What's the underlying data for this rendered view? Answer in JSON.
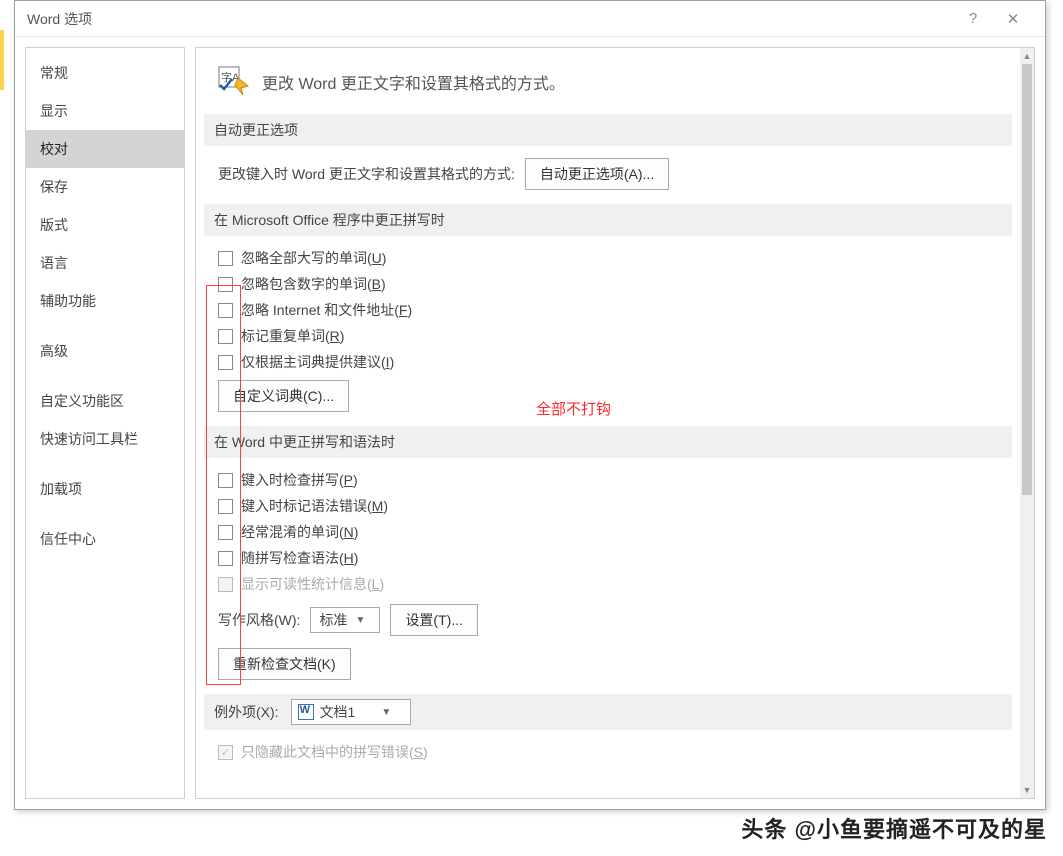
{
  "title": "Word 选项",
  "titlebar": {
    "help": "?",
    "close": "✕"
  },
  "sidebar": {
    "items": [
      {
        "label": "常规",
        "selected": false
      },
      {
        "label": "显示",
        "selected": false
      },
      {
        "label": "校对",
        "selected": true
      },
      {
        "label": "保存",
        "selected": false
      },
      {
        "label": "版式",
        "selected": false
      },
      {
        "label": "语言",
        "selected": false
      },
      {
        "label": "辅助功能",
        "selected": false
      },
      {
        "label": "高级",
        "selected": false
      },
      {
        "label": "自定义功能区",
        "selected": false
      },
      {
        "label": "快速访问工具栏",
        "selected": false
      },
      {
        "label": "加载项",
        "selected": false
      },
      {
        "label": "信任中心",
        "selected": false
      }
    ]
  },
  "header": {
    "text": "更改 Word 更正文字和设置其格式的方式。"
  },
  "section1": {
    "title": "自动更正选项",
    "text": "更改键入时 Word 更正文字和设置其格式的方式:",
    "button": "自动更正选项(A)..."
  },
  "section2": {
    "title": "在 Microsoft Office 程序中更正拼写时",
    "checks": [
      {
        "label": "忽略全部大写的单词",
        "key": "U"
      },
      {
        "label": "忽略包含数字的单词",
        "key": "B"
      },
      {
        "label": "忽略 Internet 和文件地址",
        "key": "F"
      },
      {
        "label": "标记重复单词",
        "key": "R"
      },
      {
        "label": "仅根据主词典提供建议",
        "key": "I"
      }
    ],
    "button": "自定义词典(C)...",
    "note": "全部不打钩"
  },
  "section3": {
    "title": "在 Word 中更正拼写和语法时",
    "checks": [
      {
        "label": "键入时检查拼写",
        "key": "P",
        "disabled": false
      },
      {
        "label": "键入时标记语法错误",
        "key": "M",
        "disabled": false
      },
      {
        "label": "经常混淆的单词",
        "key": "N",
        "disabled": false
      },
      {
        "label": "随拼写检查语法",
        "key": "H",
        "disabled": false
      },
      {
        "label": "显示可读性统计信息",
        "key": "L",
        "disabled": true
      }
    ],
    "style_label": "写作风格(W):",
    "style_value": "标准",
    "settings_btn": "设置(T)...",
    "recheck_btn": "重新检查文档(K)"
  },
  "section4": {
    "title_label": "例外项(X):",
    "doc_value": "文档1",
    "hide_label": "只隐藏此文档中的拼写错误",
    "hide_key": "S"
  },
  "watermark": "头条 @小鱼要摘遥不可及的星"
}
